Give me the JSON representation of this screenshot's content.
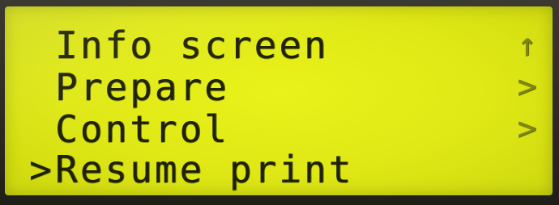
{
  "lcd_menu": {
    "cursor_symbol": ">",
    "items": [
      {
        "label": "Info screen",
        "marker": "↑",
        "marker_icon": "back-arrow-icon"
      },
      {
        "label": "Prepare",
        "marker": ">",
        "marker_icon": "submenu-chevron-icon"
      },
      {
        "label": "Control",
        "marker": ">",
        "marker_icon": "submenu-chevron-icon"
      },
      {
        "label": "Resume print",
        "marker": "",
        "marker_icon": ""
      }
    ],
    "selected_index": 3
  },
  "colors": {
    "backlight": "#e4ee18",
    "pixel": "#1e2104",
    "bezel": "#2a2a22"
  }
}
